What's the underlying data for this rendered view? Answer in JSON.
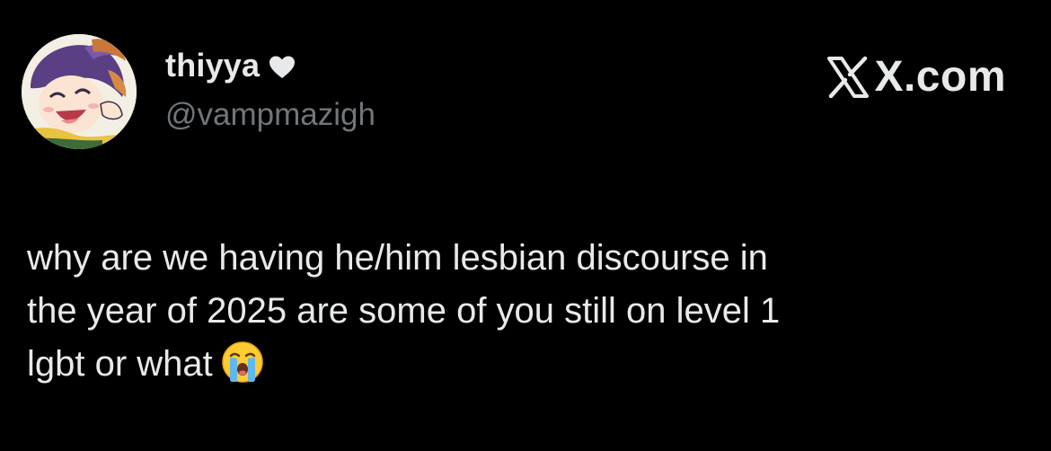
{
  "post": {
    "display_name": "thiyya",
    "handle": "@vampmazigh",
    "brand": "X.com",
    "text_lines": [
      "why are we having he/him lesbian discourse in",
      "the year of 2025 are some of you still on level 1",
      "lgbt or what"
    ]
  },
  "icons": {
    "name_badge": "heart-icon",
    "brand_logo": "x-logo-icon",
    "trailing_emoji": "loudly-crying-face-icon"
  },
  "colors": {
    "background": "#000000",
    "primary_text": "#e7e9ea",
    "secondary_text": "#71767b"
  }
}
